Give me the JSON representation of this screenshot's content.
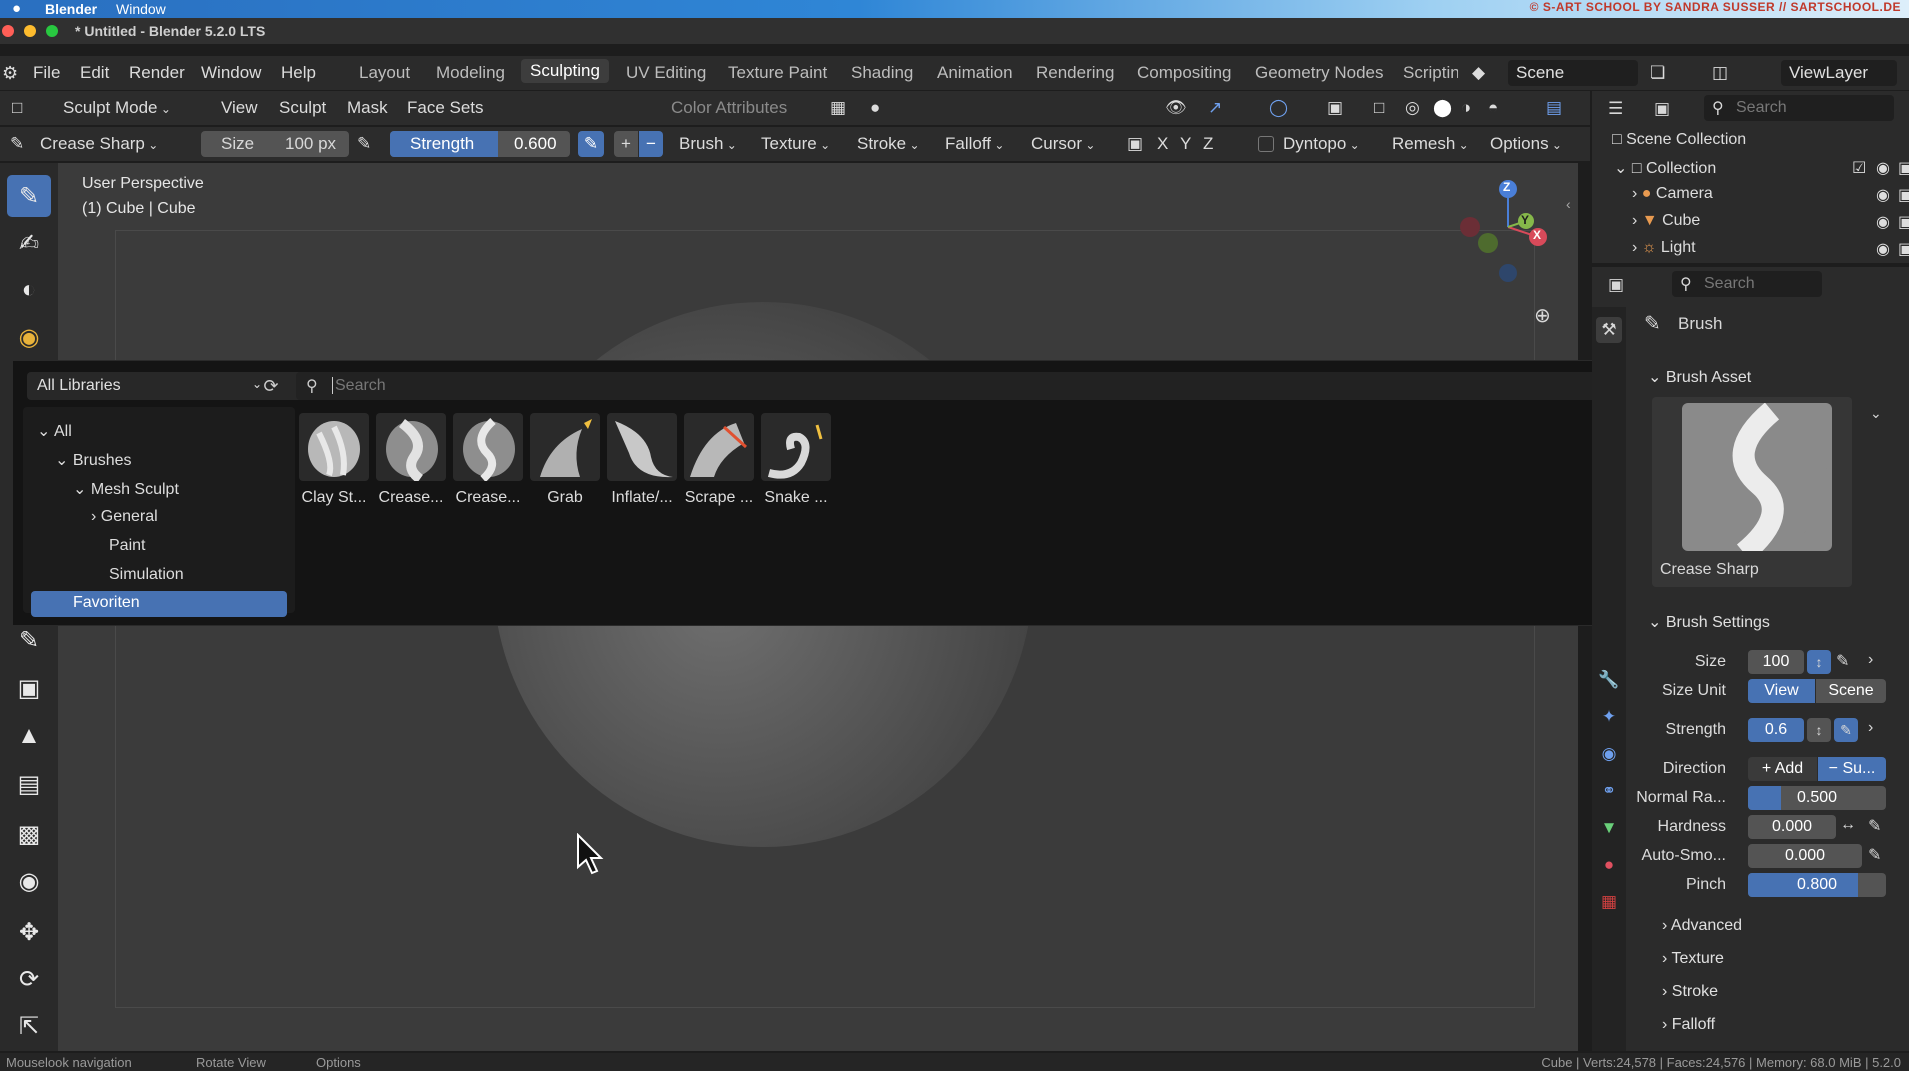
{
  "macbar": {
    "apple": "",
    "app": "Blender",
    "menu": "Window",
    "credit": "© S-ART SCHOOL BY SANDRA SUSSER // SARTSCHOOL.DE"
  },
  "window": {
    "title": "* Untitled - Blender 5.2.0 LTS"
  },
  "menus": [
    "File",
    "Edit",
    "Render",
    "Window",
    "Help"
  ],
  "workspaces": [
    "Layout",
    "Modeling",
    "Sculpting",
    "UV Editing",
    "Texture Paint",
    "Shading",
    "Animation",
    "Rendering",
    "Compositing",
    "Geometry Nodes",
    "Scriptin"
  ],
  "scene": "Scene",
  "viewlayer": "ViewLayer",
  "header1": {
    "mode": "Sculpt Mode",
    "view": "View",
    "sculpt": "Sculpt",
    "mask": "Mask",
    "facesets": "Face Sets",
    "colorattr": "Color Attributes"
  },
  "header2": {
    "brush_name": "Crease Sharp",
    "size_label": "Size",
    "size_value": "100 px",
    "strength_label": "Strength",
    "strength_value": "0.600",
    "plus": "+",
    "minus": "−",
    "brush": "Brush",
    "texture": "Texture",
    "stroke": "Stroke",
    "falloff": "Falloff",
    "cursor": "Cursor",
    "x": "X",
    "y": "Y",
    "z": "Z",
    "dyntopo": "Dyntopo",
    "remesh": "Remesh",
    "options": "Options"
  },
  "viewport": {
    "perspective": "User Perspective",
    "object": "(1) Cube | Cube",
    "axis_x": "X",
    "axis_y": "Y",
    "axis_z": "Z"
  },
  "popup": {
    "library": "All Libraries",
    "search_placeholder": "Search",
    "tree": [
      "All",
      "Brushes",
      "Mesh Sculpt",
      "General",
      "Paint",
      "Simulation",
      "Favoriten"
    ],
    "assets": [
      "Clay St...",
      "Crease...",
      "Crease...",
      "Grab",
      "Inflate/...",
      "Scrape ...",
      "Snake ..."
    ]
  },
  "outliner": {
    "search_placeholder": "Search",
    "scene_collection": "Scene Collection",
    "collection": "Collection",
    "items": [
      "Camera",
      "Cube",
      "Light"
    ]
  },
  "properties": {
    "search_placeholder": "Search",
    "tab_title": "Brush",
    "brush_asset": "Brush Asset",
    "asset_name": "Crease Sharp",
    "brush_settings": "Brush Settings",
    "size_label": "Size",
    "size_value": "100",
    "size_unit_label": "Size Unit",
    "size_unit_view": "View",
    "size_unit_scene": "Scene",
    "strength_label": "Strength",
    "strength_value": "0.6",
    "direction_label": "Direction",
    "direction_add": "Add",
    "direction_sub": "Su...",
    "normal_label": "Normal Ra...",
    "normal_value": "0.500",
    "hardness_label": "Hardness",
    "hardness_value": "0.000",
    "autosmooth_label": "Auto-Smo...",
    "autosmooth_value": "0.000",
    "pinch_label": "Pinch",
    "pinch_value": "0.800",
    "sections": [
      "Advanced",
      "Texture",
      "Stroke",
      "Falloff"
    ],
    "normal_fraction": 0.24,
    "pinch_fraction": 0.8
  },
  "status": {
    "left1": "Mouselook navigation",
    "left2": "Rotate View",
    "left3": "Options",
    "right": "Cube | Verts:24,578 | Faces:24,576 | Memory: 68.0 MiB | 5.2.0"
  },
  "colors": {
    "accent": "#4772b3",
    "panel": "#2b2b2b",
    "viewport": "#3b3b3b"
  }
}
